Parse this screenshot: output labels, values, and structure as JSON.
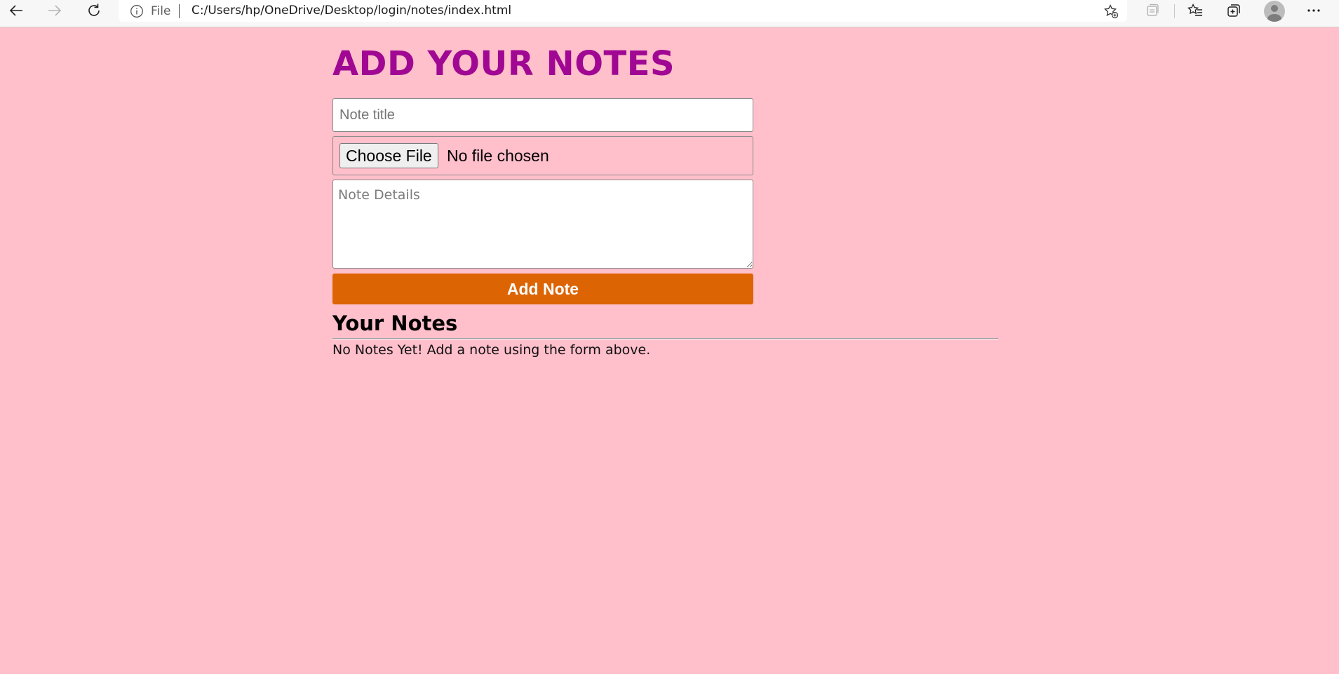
{
  "browser": {
    "address_scheme": "File",
    "url": "C:/Users/hp/OneDrive/Desktop/login/notes/index.html",
    "icons": [
      "back-icon",
      "forward-icon",
      "refresh-icon",
      "info-icon",
      "add-favorite-icon",
      "collections-read-icon",
      "favorites-icon",
      "collections-icon",
      "profile-icon",
      "more-icon"
    ]
  },
  "page": {
    "title": "ADD YOUR NOTES",
    "note_title_placeholder": "Note title",
    "file_button_label": "Choose File",
    "file_status": "No file chosen",
    "note_details_placeholder": "Note Details",
    "add_button_label": "Add Note",
    "notes_heading": "Your Notes",
    "empty_message": "No Notes Yet! Add a note using the form above."
  },
  "colors": {
    "background": "#ffbfcb",
    "title": "#a00893",
    "add_button": "#dd6402"
  }
}
